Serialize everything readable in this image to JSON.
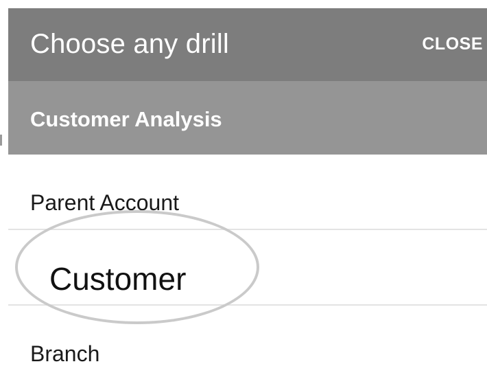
{
  "dialog": {
    "title": "Choose any drill",
    "close_label": "CLOSE"
  },
  "section": {
    "title": "Customer Analysis"
  },
  "items": [
    {
      "label": "Parent Account"
    },
    {
      "label": "Customer"
    },
    {
      "label": "Branch"
    }
  ],
  "colors": {
    "header_bg": "#7d7d7d",
    "section_bg": "#959595",
    "divider": "#e3e3e3",
    "highlight_ring": "#cacaca"
  }
}
